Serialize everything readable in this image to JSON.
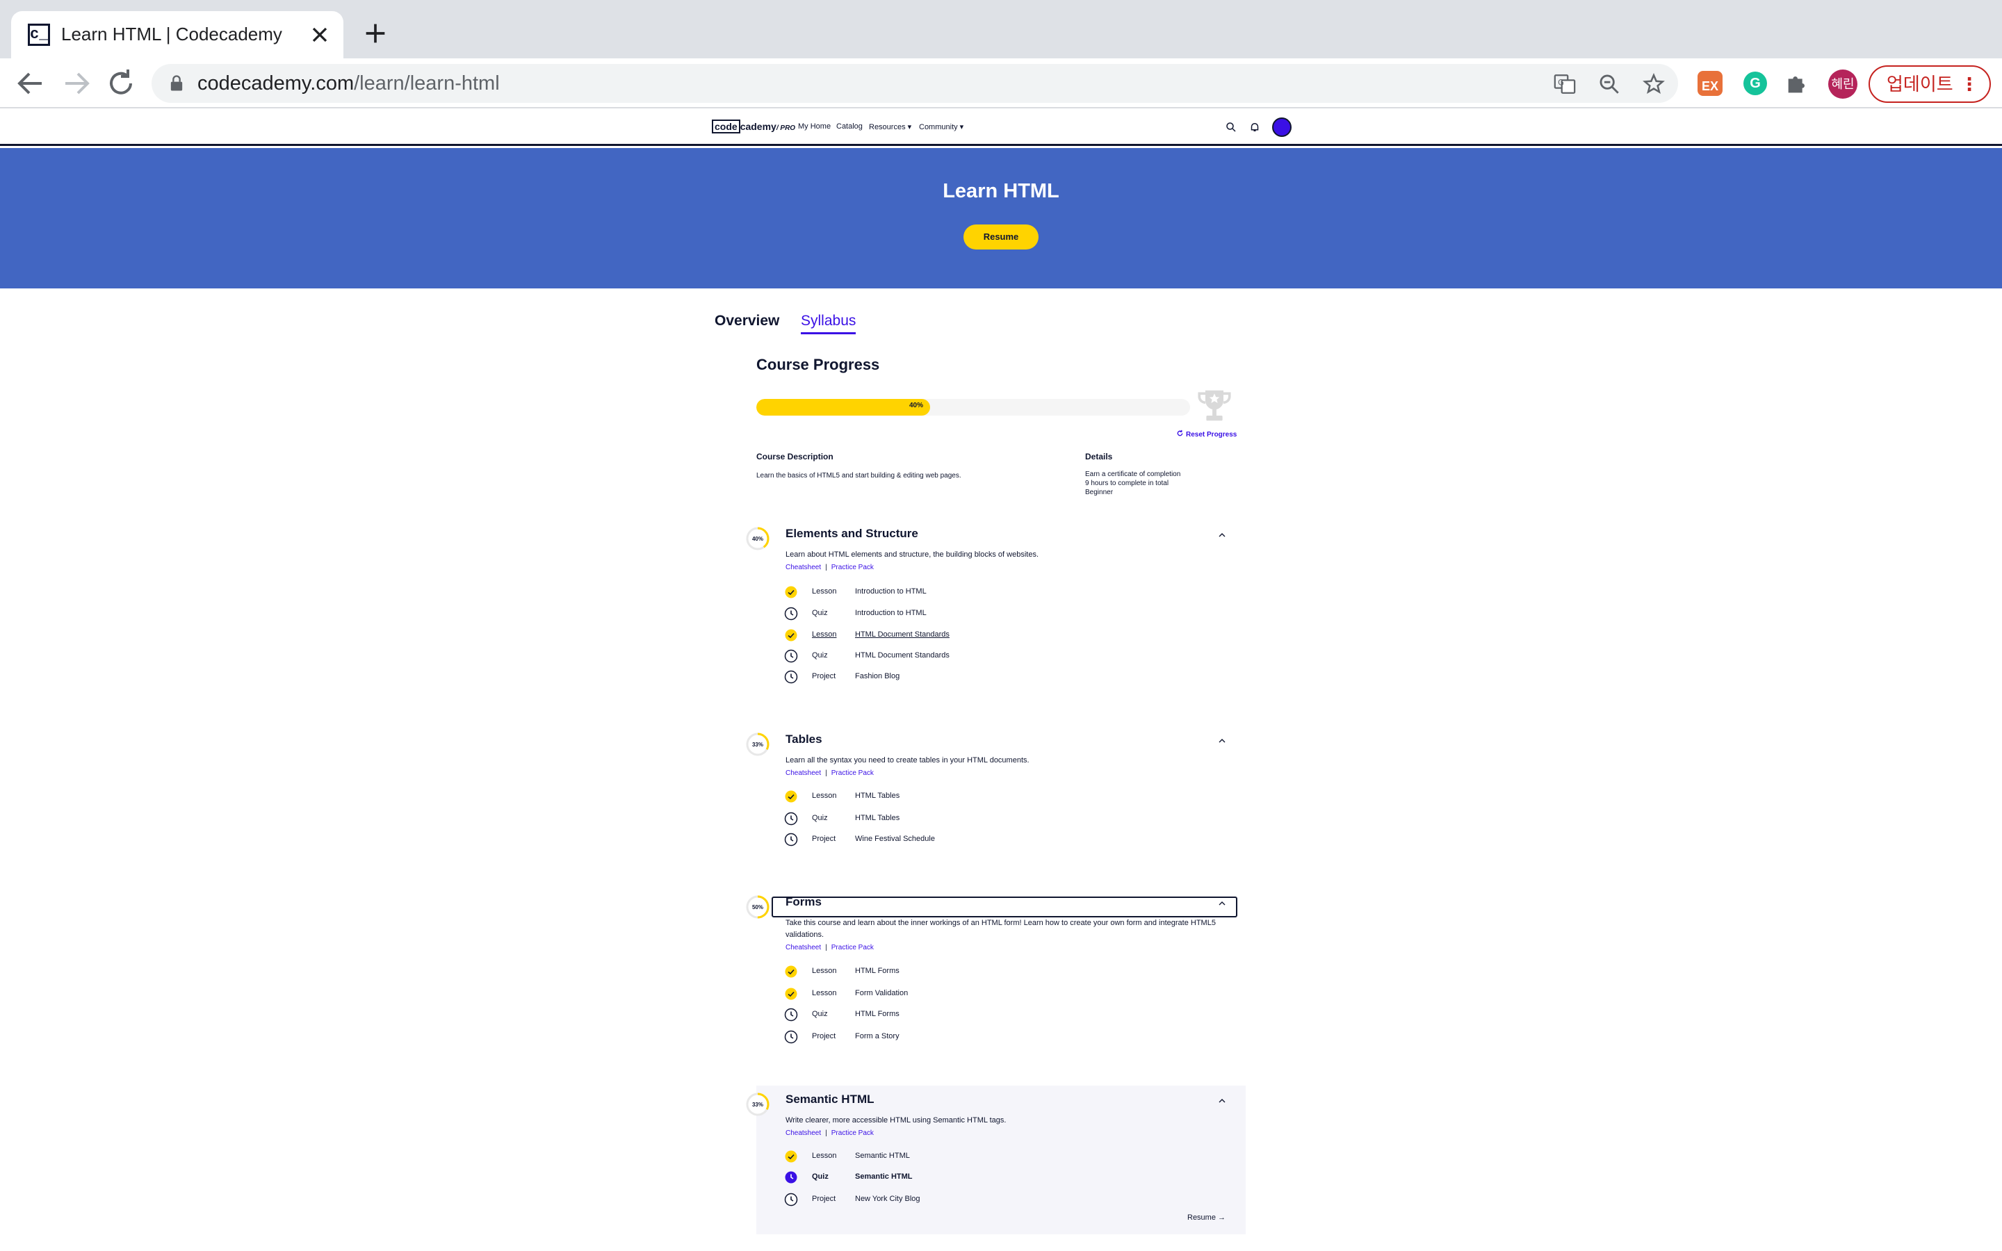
{
  "browser": {
    "tab_title": "Learn HTML | Codecademy",
    "favicon_text": "c_",
    "url_host": "codecademy.com",
    "url_path": "/learn/learn-html",
    "ext_ex_label": "EX",
    "ext_g_label": "G",
    "profile_label": "혜린",
    "update_label": "업데이트"
  },
  "site": {
    "logo_code": "code",
    "logo_rest": "cademy",
    "logo_pro": "/ PRO",
    "nav": [
      "My Home",
      "Catalog",
      "Resources ▾",
      "Community ▾"
    ]
  },
  "hero": {
    "title": "Learn HTML",
    "resume_label": "Resume"
  },
  "tabs": {
    "overview": "Overview",
    "syllabus": "Syllabus"
  },
  "progress": {
    "title": "Course Progress",
    "percent_label": "40%",
    "percent_value": 0.4,
    "reset_label": "Reset Progress"
  },
  "description": {
    "heading": "Course Description",
    "text": "Learn the basics of HTML5 and start building & editing web pages.",
    "details_heading": "Details",
    "details": [
      "Earn a certificate of completion",
      "9 hours to complete in total",
      "Beginner"
    ]
  },
  "modules": [
    {
      "percent": "40%",
      "title": "Elements and Structure",
      "description": "Learn about HTML elements and structure, the building blocks of websites.",
      "links": [
        "Cheatsheet",
        "Practice Pack"
      ],
      "items": [
        {
          "type": "Lesson",
          "name": "Introduction to HTML",
          "status": "done"
        },
        {
          "type": "Quiz",
          "name": "Introduction to HTML",
          "status": "todo"
        },
        {
          "type": "Lesson",
          "name": "HTML Document Standards",
          "status": "done"
        },
        {
          "type": "Quiz",
          "name": "HTML Document Standards",
          "status": "todo"
        },
        {
          "type": "Project",
          "name": "Fashion Blog",
          "status": "todo"
        }
      ]
    },
    {
      "percent": "33%",
      "title": "Tables",
      "description": "Learn all the syntax you need to create tables in your HTML documents.",
      "links": [
        "Cheatsheet",
        "Practice Pack"
      ],
      "items": [
        {
          "type": "Lesson",
          "name": "HTML Tables",
          "status": "done"
        },
        {
          "type": "Quiz",
          "name": "HTML Tables",
          "status": "todo"
        },
        {
          "type": "Project",
          "name": "Wine Festival Schedule",
          "status": "todo"
        }
      ]
    },
    {
      "percent": "50%",
      "title": "Forms",
      "description": "Take this course and learn about the inner workings of an HTML form! Learn how to create your own form and integrate HTML5 validations.",
      "links": [
        "Cheatsheet",
        "Practice Pack"
      ],
      "items": [
        {
          "type": "Lesson",
          "name": "HTML Forms",
          "status": "done"
        },
        {
          "type": "Lesson",
          "name": "Form Validation",
          "status": "done"
        },
        {
          "type": "Quiz",
          "name": "HTML Forms",
          "status": "todo"
        },
        {
          "type": "Project",
          "name": "Form a Story",
          "status": "todo"
        }
      ]
    },
    {
      "percent": "33%",
      "title": "Semantic HTML",
      "description": "Write clearer, more accessible HTML using Semantic HTML tags.",
      "links": [
        "Cheatsheet",
        "Practice Pack"
      ],
      "items": [
        {
          "type": "Lesson",
          "name": "Semantic HTML",
          "status": "done"
        },
        {
          "type": "Quiz",
          "name": "Semantic HTML",
          "status": "current"
        },
        {
          "type": "Project",
          "name": "New York City Blog",
          "status": "todo"
        }
      ],
      "resume_label": "Resume →"
    }
  ],
  "colors": {
    "hero": "#4266c2",
    "accent_yellow": "#ffd300",
    "accent_purple": "#3a10e5",
    "ink": "#10162f"
  }
}
